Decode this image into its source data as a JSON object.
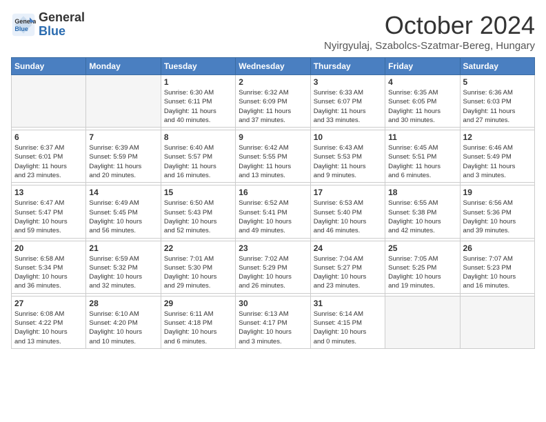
{
  "header": {
    "logo": {
      "line1": "General",
      "line2": "Blue"
    },
    "title": "October 2024",
    "subtitle": "Nyirgyulaj, Szabolcs-Szatmar-Bereg, Hungary"
  },
  "weekdays": [
    "Sunday",
    "Monday",
    "Tuesday",
    "Wednesday",
    "Thursday",
    "Friday",
    "Saturday"
  ],
  "weeks": [
    [
      {
        "day": "",
        "info": ""
      },
      {
        "day": "",
        "info": ""
      },
      {
        "day": "1",
        "info": "Sunrise: 6:30 AM\nSunset: 6:11 PM\nDaylight: 11 hours\nand 40 minutes."
      },
      {
        "day": "2",
        "info": "Sunrise: 6:32 AM\nSunset: 6:09 PM\nDaylight: 11 hours\nand 37 minutes."
      },
      {
        "day": "3",
        "info": "Sunrise: 6:33 AM\nSunset: 6:07 PM\nDaylight: 11 hours\nand 33 minutes."
      },
      {
        "day": "4",
        "info": "Sunrise: 6:35 AM\nSunset: 6:05 PM\nDaylight: 11 hours\nand 30 minutes."
      },
      {
        "day": "5",
        "info": "Sunrise: 6:36 AM\nSunset: 6:03 PM\nDaylight: 11 hours\nand 27 minutes."
      }
    ],
    [
      {
        "day": "6",
        "info": "Sunrise: 6:37 AM\nSunset: 6:01 PM\nDaylight: 11 hours\nand 23 minutes."
      },
      {
        "day": "7",
        "info": "Sunrise: 6:39 AM\nSunset: 5:59 PM\nDaylight: 11 hours\nand 20 minutes."
      },
      {
        "day": "8",
        "info": "Sunrise: 6:40 AM\nSunset: 5:57 PM\nDaylight: 11 hours\nand 16 minutes."
      },
      {
        "day": "9",
        "info": "Sunrise: 6:42 AM\nSunset: 5:55 PM\nDaylight: 11 hours\nand 13 minutes."
      },
      {
        "day": "10",
        "info": "Sunrise: 6:43 AM\nSunset: 5:53 PM\nDaylight: 11 hours\nand 9 minutes."
      },
      {
        "day": "11",
        "info": "Sunrise: 6:45 AM\nSunset: 5:51 PM\nDaylight: 11 hours\nand 6 minutes."
      },
      {
        "day": "12",
        "info": "Sunrise: 6:46 AM\nSunset: 5:49 PM\nDaylight: 11 hours\nand 3 minutes."
      }
    ],
    [
      {
        "day": "13",
        "info": "Sunrise: 6:47 AM\nSunset: 5:47 PM\nDaylight: 10 hours\nand 59 minutes."
      },
      {
        "day": "14",
        "info": "Sunrise: 6:49 AM\nSunset: 5:45 PM\nDaylight: 10 hours\nand 56 minutes."
      },
      {
        "day": "15",
        "info": "Sunrise: 6:50 AM\nSunset: 5:43 PM\nDaylight: 10 hours\nand 52 minutes."
      },
      {
        "day": "16",
        "info": "Sunrise: 6:52 AM\nSunset: 5:41 PM\nDaylight: 10 hours\nand 49 minutes."
      },
      {
        "day": "17",
        "info": "Sunrise: 6:53 AM\nSunset: 5:40 PM\nDaylight: 10 hours\nand 46 minutes."
      },
      {
        "day": "18",
        "info": "Sunrise: 6:55 AM\nSunset: 5:38 PM\nDaylight: 10 hours\nand 42 minutes."
      },
      {
        "day": "19",
        "info": "Sunrise: 6:56 AM\nSunset: 5:36 PM\nDaylight: 10 hours\nand 39 minutes."
      }
    ],
    [
      {
        "day": "20",
        "info": "Sunrise: 6:58 AM\nSunset: 5:34 PM\nDaylight: 10 hours\nand 36 minutes."
      },
      {
        "day": "21",
        "info": "Sunrise: 6:59 AM\nSunset: 5:32 PM\nDaylight: 10 hours\nand 32 minutes."
      },
      {
        "day": "22",
        "info": "Sunrise: 7:01 AM\nSunset: 5:30 PM\nDaylight: 10 hours\nand 29 minutes."
      },
      {
        "day": "23",
        "info": "Sunrise: 7:02 AM\nSunset: 5:29 PM\nDaylight: 10 hours\nand 26 minutes."
      },
      {
        "day": "24",
        "info": "Sunrise: 7:04 AM\nSunset: 5:27 PM\nDaylight: 10 hours\nand 23 minutes."
      },
      {
        "day": "25",
        "info": "Sunrise: 7:05 AM\nSunset: 5:25 PM\nDaylight: 10 hours\nand 19 minutes."
      },
      {
        "day": "26",
        "info": "Sunrise: 7:07 AM\nSunset: 5:23 PM\nDaylight: 10 hours\nand 16 minutes."
      }
    ],
    [
      {
        "day": "27",
        "info": "Sunrise: 6:08 AM\nSunset: 4:22 PM\nDaylight: 10 hours\nand 13 minutes."
      },
      {
        "day": "28",
        "info": "Sunrise: 6:10 AM\nSunset: 4:20 PM\nDaylight: 10 hours\nand 10 minutes."
      },
      {
        "day": "29",
        "info": "Sunrise: 6:11 AM\nSunset: 4:18 PM\nDaylight: 10 hours\nand 6 minutes."
      },
      {
        "day": "30",
        "info": "Sunrise: 6:13 AM\nSunset: 4:17 PM\nDaylight: 10 hours\nand 3 minutes."
      },
      {
        "day": "31",
        "info": "Sunrise: 6:14 AM\nSunset: 4:15 PM\nDaylight: 10 hours\nand 0 minutes."
      },
      {
        "day": "",
        "info": ""
      },
      {
        "day": "",
        "info": ""
      }
    ]
  ]
}
